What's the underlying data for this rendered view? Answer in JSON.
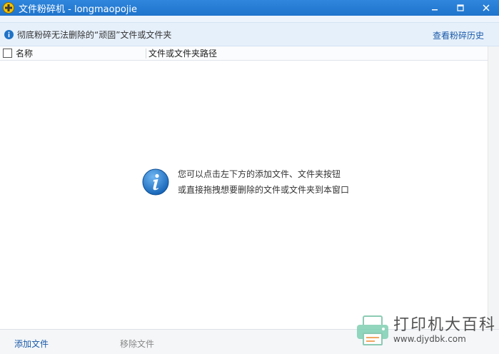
{
  "window": {
    "title": "文件粉碎机 - longmaopojie"
  },
  "infobar": {
    "text": "彻底粉碎无法删除的“顽固”文件或文件夹",
    "history_link": "查看粉碎历史"
  },
  "table": {
    "columns": [
      "名称",
      "文件或文件夹路径"
    ]
  },
  "empty_state": {
    "line1": "您可以点击左下方的添加文件、文件夹按钮",
    "line2": "或直接拖拽想要删除的文件或文件夹到本窗口"
  },
  "bottom": {
    "add_file": "添加文件",
    "remove_file": "移除文件"
  },
  "watermark": {
    "text": "打印机大百科",
    "url": "www.djydbk.com"
  },
  "colors": {
    "titlebar": "#1f74cc",
    "link": "#1a5aa8",
    "info_icon": "#1e72c6"
  }
}
